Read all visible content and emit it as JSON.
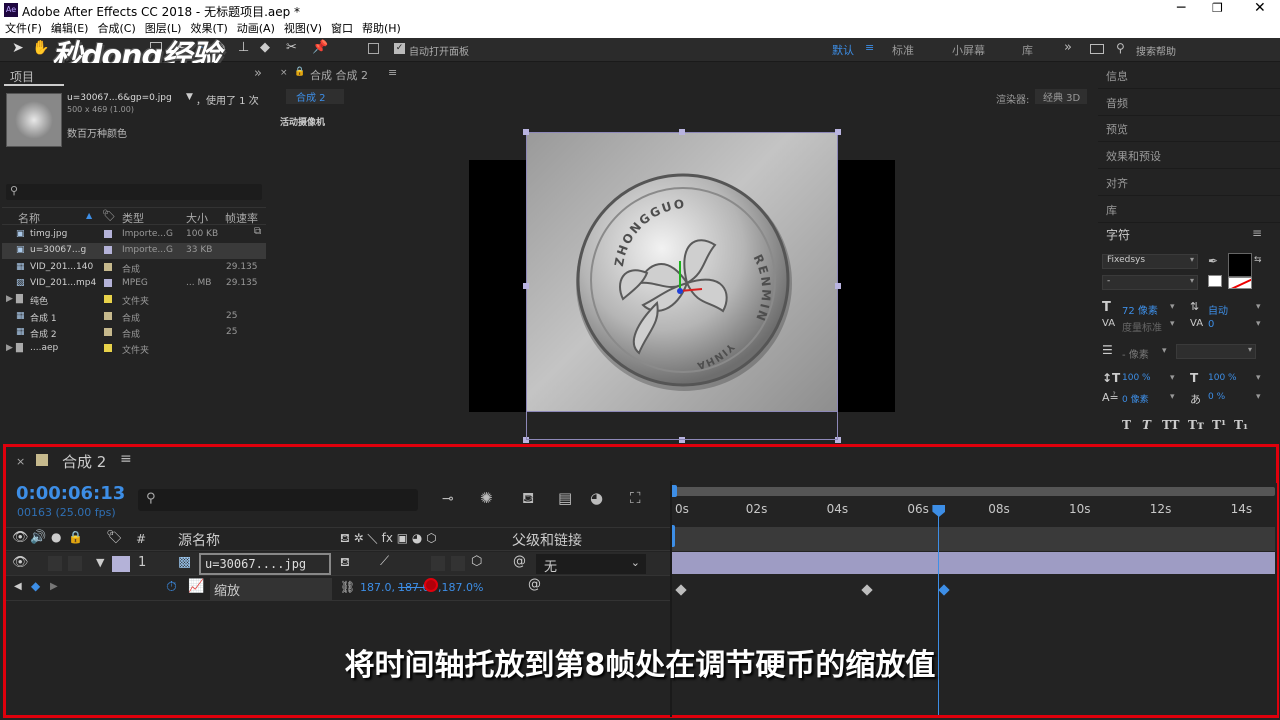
{
  "window": {
    "title": "Adobe After Effects CC 2018 - 无标题项目.aep *",
    "app_icon": "Ae",
    "controls": [
      "minimize-icon",
      "maximize-icon",
      "close-icon"
    ]
  },
  "menu": [
    "文件(F)",
    "编辑(E)",
    "合成(C)",
    "图层(L)",
    "效果(T)",
    "动画(A)",
    "视图(V)",
    "窗口",
    "帮助(H)"
  ],
  "watermark": "秒dong经验",
  "toolbar": {
    "auto_open_label": "自动打开面板",
    "workspaces": [
      "默认",
      "标准",
      "小屏幕",
      "库"
    ],
    "search_placeholder": "搜索帮助"
  },
  "project_panel": {
    "tab_label": "项目",
    "selected_name": "u=30067...6&gp=0.jpg",
    "used_count": "，使用了 1 次",
    "dimensions": "500 x 469 (1.00)",
    "color_info": "数百万种颜色",
    "columns": [
      "名称",
      "类型",
      "大小",
      "帧速率"
    ],
    "items": [
      {
        "name": "timg.jpg",
        "type": "Importe...G",
        "size": "100 KB",
        "fps": "",
        "color": "#b4b2d8",
        "icon": "image-icon",
        "selected": false
      },
      {
        "name": "u=30067...g",
        "type": "Importe...G",
        "size": "33 KB",
        "fps": "",
        "color": "#b4b2d8",
        "icon": "image-icon",
        "selected": true
      },
      {
        "name": "VID_201...140",
        "type": "合成",
        "size": "",
        "fps": "29.135",
        "color": "#c6b98d",
        "icon": "comp-icon",
        "selected": false
      },
      {
        "name": "VID_201...mp4",
        "type": "MPEG",
        "size": "... MB",
        "fps": "29.135",
        "color": "#b4b2d8",
        "icon": "video-icon",
        "selected": false
      },
      {
        "name": "纯色",
        "type": "文件夹",
        "size": "",
        "fps": "",
        "color": "#e8d24a",
        "icon": "folder-icon",
        "selected": false
      },
      {
        "name": "合成 1",
        "type": "合成",
        "size": "",
        "fps": "25",
        "color": "#c6b98d",
        "icon": "comp-icon",
        "selected": false
      },
      {
        "name": "合成 2",
        "type": "合成",
        "size": "",
        "fps": "25",
        "color": "#c6b98d",
        "icon": "comp-icon",
        "selected": false
      },
      {
        "name": "....aep",
        "type": "文件夹",
        "size": "",
        "fps": "",
        "color": "#e8d24a",
        "icon": "folder-icon",
        "selected": false
      }
    ]
  },
  "comp_panel": {
    "tab_label": "合成 合成 2",
    "sub_tab": "合成 2",
    "renderer_label": "渲染器:",
    "renderer_value": "经典 3D",
    "camera_label": "活动摄像机"
  },
  "right_panel": {
    "items": [
      "信息",
      "音频",
      "预览",
      "效果和预设",
      "对齐",
      "库"
    ],
    "character": {
      "title": "字符",
      "font": "Fixedsys",
      "style": "-",
      "size": "72 像素",
      "leading": "自动",
      "kerning": "度量标准",
      "tracking": "0",
      "stroke": "- 像素",
      "v_scale": "100 %",
      "h_scale": "100 %",
      "baseline": "0 像素",
      "tsume": "0 %",
      "styles": [
        "T",
        "T",
        "TT",
        "Tт",
        "T¹",
        "T₁"
      ]
    }
  },
  "timeline": {
    "tab_label": "合成 2",
    "timecode": "0:00:06:13",
    "frame_info": "00163 (25.00 fps)",
    "columns": {
      "source": "源名称",
      "parent": "父级和链接"
    },
    "layer": {
      "number": "1",
      "name": "u=30067....jpg",
      "parent": "无",
      "color": "#b4b2d8"
    },
    "property": {
      "name": "缩放",
      "value_a": "187.0,",
      "value_b": "187.0",
      "value_c": ",187.0%"
    },
    "ruler": [
      "0s",
      "02s",
      "04s",
      "06s",
      "08s",
      "10s",
      "12s",
      "14s"
    ],
    "playhead_seconds": 6.52,
    "keyframes_seconds": [
      0,
      4.6,
      6.52
    ]
  },
  "subtitle": "将时间轴托放到第8帧处在调节硬币的缩放值",
  "coin_text": {
    "top": "ZHONGGUO",
    "right": "RENMIN",
    "bottom": "YINHANG"
  }
}
